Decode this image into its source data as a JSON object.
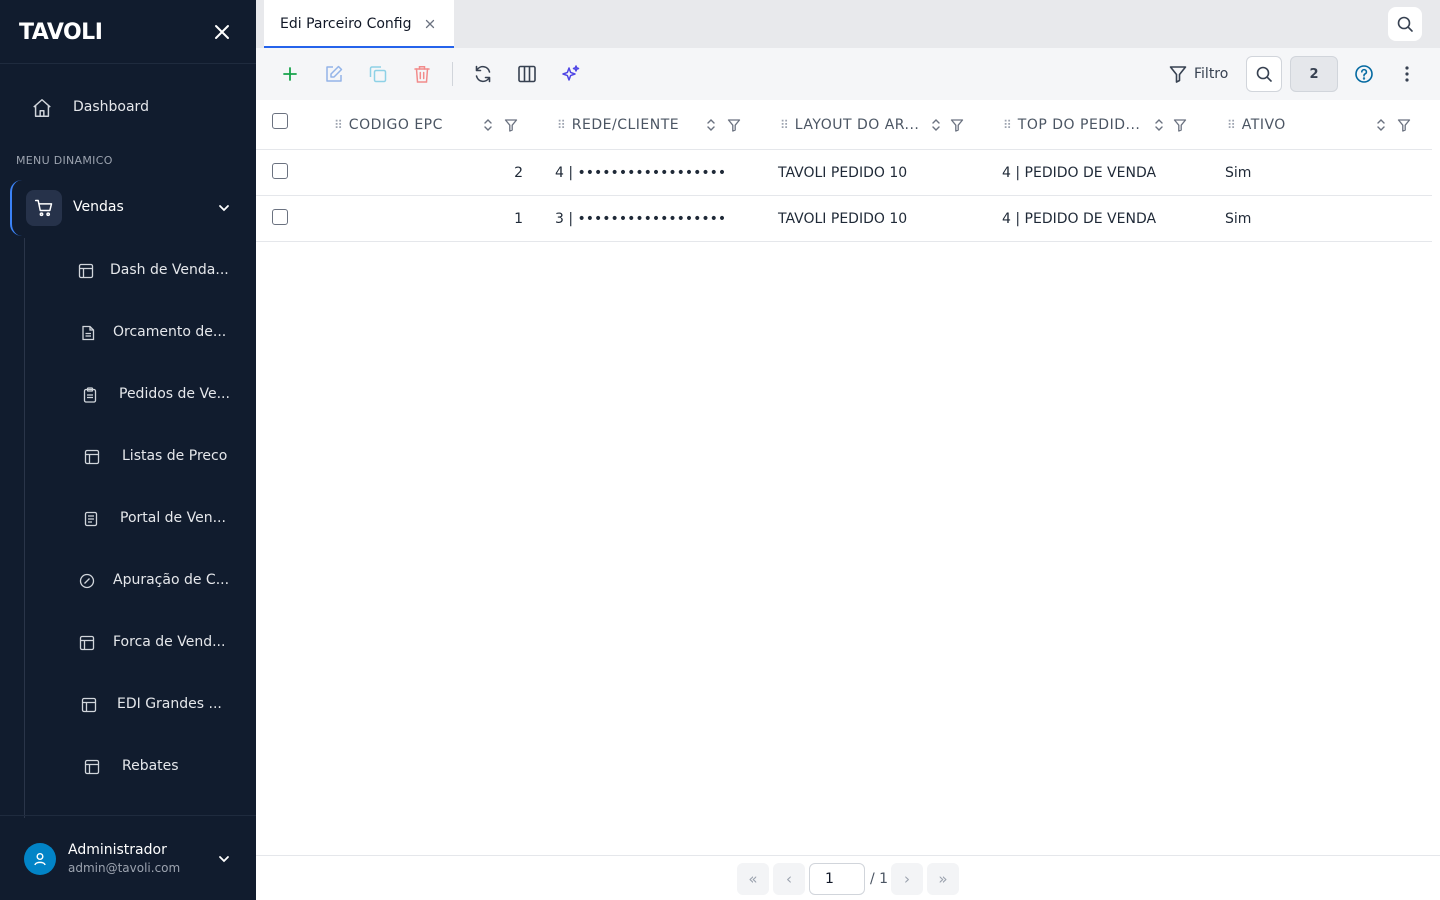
{
  "sidebar": {
    "logo": "TAVOLI",
    "dashboard_label": "Dashboard",
    "section_label": "MENU DINAMICO",
    "group_label": "Vendas",
    "items": [
      {
        "label": "Dash de Venda...",
        "icon": "layout-icon"
      },
      {
        "label": "Orcamento de...",
        "icon": "file-text-icon"
      },
      {
        "label": "Pedidos de Ve...",
        "icon": "clipboard-icon"
      },
      {
        "label": "Listas de Preco",
        "icon": "layout-icon"
      },
      {
        "label": "Portal de Ven...",
        "icon": "document-icon"
      },
      {
        "label": "Apuração de C...",
        "icon": "gauge-icon"
      },
      {
        "label": "Forca de Vend...",
        "icon": "layout-icon"
      },
      {
        "label": "EDI Grandes ...",
        "icon": "layout-icon"
      },
      {
        "label": "Rebates",
        "icon": "layout-icon"
      }
    ],
    "user": {
      "name": "Administrador",
      "email": "admin@tavoli.com"
    }
  },
  "tabs": [
    {
      "label": "Edi Parceiro Config",
      "active": true
    }
  ],
  "toolbar": {
    "filter_label": "Filtro",
    "record_count": "2"
  },
  "grid": {
    "columns": [
      "CODIGO EPC",
      "REDE/CLIENTE",
      "LAYOUT DO AR...",
      "TOP DO PEDID...",
      "ATIVO"
    ],
    "rows": [
      {
        "codigo": "2",
        "rede": "4 | ••••••••••••••••••",
        "layout": "TAVOLI PEDIDO 10",
        "top": "4 | PEDIDO DE VENDA",
        "ativo": "Sim"
      },
      {
        "codigo": "1",
        "rede": "3 | ••••••••••••••••••",
        "layout": "TAVOLI PEDIDO 10",
        "top": "4 | PEDIDO DE VENDA",
        "ativo": "Sim"
      }
    ]
  },
  "pager": {
    "current": "1",
    "total": "/ 1",
    "first": "«",
    "prev": "‹",
    "next": "›",
    "last": "»"
  },
  "colors": {
    "sidebar_bg": "#111c2e",
    "accent": "#2563eb",
    "add": "#16a34a",
    "delete": "#ef4444",
    "ai": "#4f46e5",
    "help": "#0369a1"
  }
}
